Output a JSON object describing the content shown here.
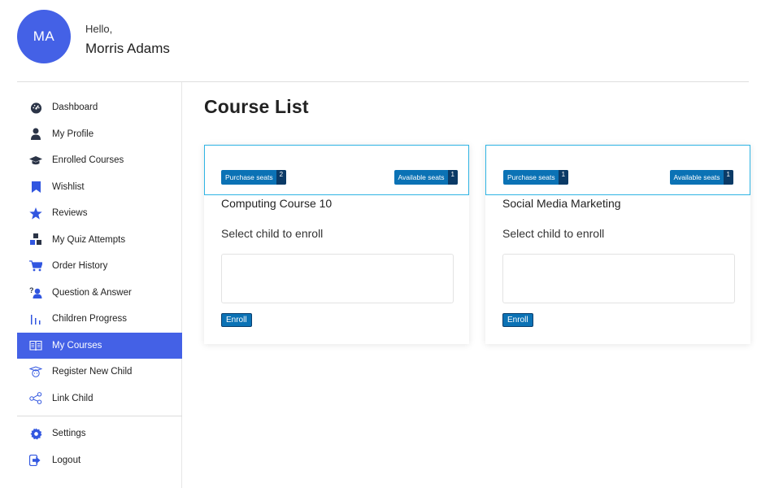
{
  "user": {
    "initials": "MA",
    "greeting": "Hello,",
    "name": "Morris Adams"
  },
  "sidebar": {
    "items": [
      {
        "label": "Dashboard",
        "icon": "dashboard-icon"
      },
      {
        "label": "My Profile",
        "icon": "user-icon"
      },
      {
        "label": "Enrolled Courses",
        "icon": "graduation-cap-icon"
      },
      {
        "label": "Wishlist",
        "icon": "bookmark-icon"
      },
      {
        "label": "Reviews",
        "icon": "star-icon"
      },
      {
        "label": "My Quiz Attempts",
        "icon": "quiz-cubes-icon"
      },
      {
        "label": "Order History",
        "icon": "cart-icon"
      },
      {
        "label": "Question & Answer",
        "icon": "question-answer-icon"
      },
      {
        "label": "Children Progress",
        "icon": "progress-bars-icon"
      },
      {
        "label": "My Courses",
        "icon": "book-icon",
        "active": true
      },
      {
        "label": "Register New Child",
        "icon": "child-icon"
      },
      {
        "label": "Link Child",
        "icon": "share-link-icon"
      }
    ],
    "footer": [
      {
        "label": "Settings",
        "icon": "gear-icon"
      },
      {
        "label": "Logout",
        "icon": "logout-icon"
      }
    ]
  },
  "main": {
    "title": "Course List",
    "courses": [
      {
        "title": "Computing Course 10",
        "purchase_label": "Purchase seats",
        "purchase_count": "2",
        "available_label": "Available seats",
        "available_count": "1",
        "select_label": "Select child to enroll",
        "enroll_label": "Enroll"
      },
      {
        "title": "Social Media Marketing",
        "purchase_label": "Purchase seats",
        "purchase_count": "1",
        "available_label": "Available seats",
        "available_count": "1",
        "select_label": "Select child to enroll",
        "enroll_label": "Enroll"
      }
    ]
  },
  "colors": {
    "accent": "#4461e6",
    "badge": "#0b72b5",
    "badge_count": "#0b3a66",
    "card_border": "#2fb4e4"
  }
}
